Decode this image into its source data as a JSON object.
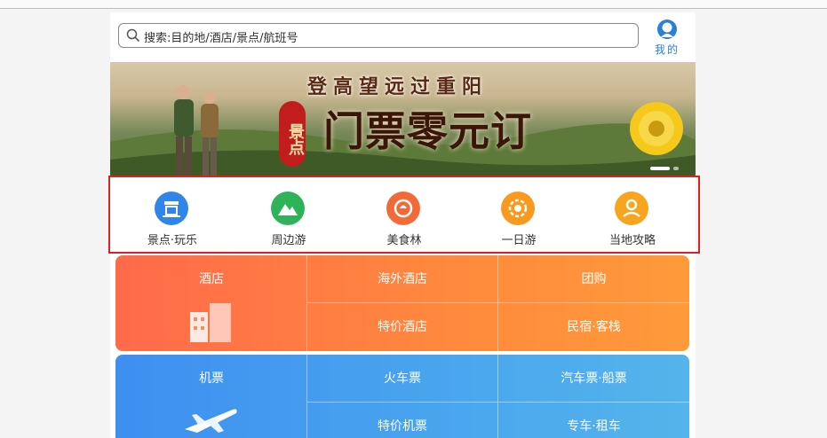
{
  "search": {
    "placeholder": "搜索:目的地/酒店/景点/航班号"
  },
  "mine": {
    "label": "我的"
  },
  "banner": {
    "subtitle": "登高望远过重阳",
    "title": "门票零元订",
    "tag": "景点"
  },
  "quick_entries": [
    {
      "label": "景点·玩乐",
      "color": "#2f86e8",
      "icon": "temple-icon"
    },
    {
      "label": "周边游",
      "color": "#2fb35a",
      "icon": "mountain-icon"
    },
    {
      "label": "美食林",
      "color": "#f36a3a",
      "icon": "food-icon"
    },
    {
      "label": "一日游",
      "color": "#f79a1f",
      "icon": "sun-badge-icon"
    },
    {
      "label": "当地攻略",
      "color": "#f7a51f",
      "icon": "guide-person-icon"
    }
  ],
  "grid": {
    "row1": {
      "main": "酒店",
      "cells": [
        "海外酒店",
        "团购",
        "特价酒店",
        "民宿·客栈"
      ],
      "color": "#ff7346"
    },
    "row2": {
      "main": "机票",
      "cells": [
        "火车票",
        "汽车票·船票",
        "特价机票",
        "专车·租车"
      ],
      "color": "#4498ef"
    }
  }
}
